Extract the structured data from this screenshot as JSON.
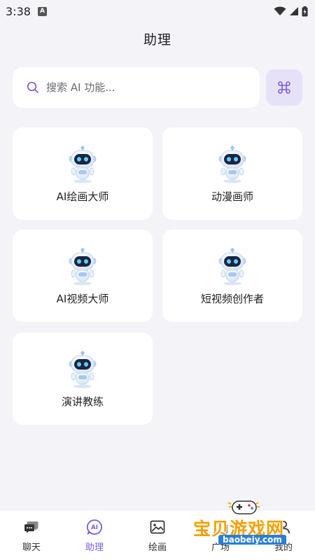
{
  "status_bar": {
    "time": "3:38",
    "notif_letter": "A"
  },
  "header": {
    "title": "助理"
  },
  "search": {
    "placeholder": "搜索 AI 功能..."
  },
  "cards": [
    {
      "label": "AI绘画大师"
    },
    {
      "label": "动漫画师"
    },
    {
      "label": "AI视频大师"
    },
    {
      "label": "短视频创作者"
    },
    {
      "label": "演讲教练"
    }
  ],
  "nav": {
    "items": [
      {
        "label": "聊天",
        "icon": "chat-icon"
      },
      {
        "label": "助理",
        "icon": "ai-assistant-icon",
        "active": true
      },
      {
        "label": "绘画",
        "icon": "image-icon"
      },
      {
        "label": "广场",
        "icon": "plaza-icon"
      },
      {
        "label": "我的",
        "icon": "profile-icon"
      }
    ]
  },
  "watermark": {
    "text": "宝贝游戏网",
    "url": "baobeiy.com"
  },
  "colors": {
    "accent": "#7c5ce0",
    "background": "#f3f3f8",
    "card": "#ffffff",
    "command_button": "#e7e1f8"
  }
}
